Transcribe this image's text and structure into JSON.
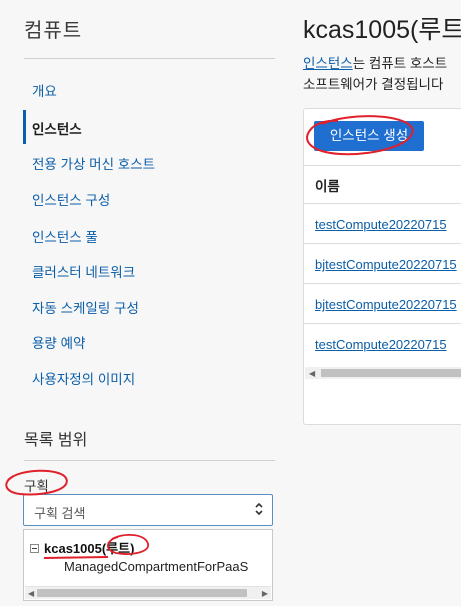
{
  "sidebar": {
    "title": "컴퓨트",
    "items": [
      {
        "label": "개요",
        "active": false
      },
      {
        "label": "인스턴스",
        "active": true
      },
      {
        "label": "전용 가상 머신 호스트",
        "active": false
      },
      {
        "label": "인스턴스 구성",
        "active": false
      },
      {
        "label": "인스턴스 풀",
        "active": false
      },
      {
        "label": "클러스터 네트워크",
        "active": false
      },
      {
        "label": "자동 스케일링 구성",
        "active": false
      },
      {
        "label": "용량 예약",
        "active": false
      },
      {
        "label": "사용자정의 이미지",
        "active": false
      }
    ]
  },
  "scope": {
    "title": "목록 범위",
    "compartment_label": "구획",
    "select_placeholder": "구획 검색",
    "tree": {
      "root_name": "kcas1005",
      "root_suffix": "(루트)",
      "child": "ManagedCompartmentForPaaS"
    }
  },
  "main": {
    "title": "kcas1005(루트",
    "desc_line1_link": "인스턴스",
    "desc_line1_rest": "는 컴퓨트 호스트",
    "desc_line2": "소프트웨어가 결정됩니다",
    "create_button": "인스턴스 생성",
    "table": {
      "column_name": "이름",
      "rows": [
        "testCompute20220715",
        "bjtestCompute20220715",
        "bjtestCompute20220715",
        "testCompute20220715"
      ]
    }
  },
  "colors": {
    "link": "#0b5ea8",
    "button": "#1f6fd1",
    "annotation": "#e0202a"
  }
}
